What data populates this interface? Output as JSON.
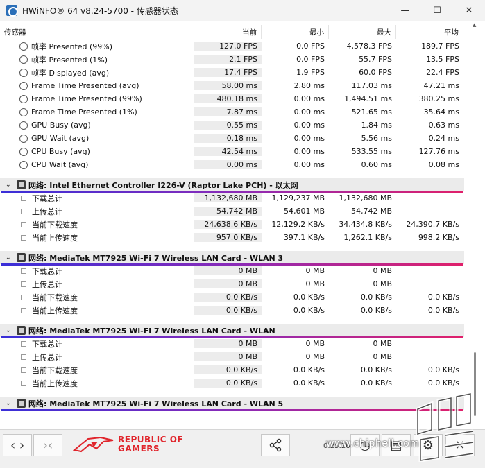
{
  "window": {
    "title": "HWiNFO® 64 v8.24-5700 - 传感器状态",
    "minimize": "—",
    "maximize": "☐",
    "close": "✕"
  },
  "columns": {
    "sensor": "传感器",
    "current": "当前",
    "min": "最小",
    "max": "最大",
    "avg": "平均"
  },
  "frame_rows": [
    {
      "name": "帧率 Presented (99%)",
      "current": "127.0 FPS",
      "min": "0.0 FPS",
      "max": "4,578.3 FPS",
      "avg": "189.7 FPS"
    },
    {
      "name": "帧率 Presented (1%)",
      "current": "2.1 FPS",
      "min": "0.0 FPS",
      "max": "55.7 FPS",
      "avg": "13.5 FPS"
    },
    {
      "name": "帧率 Displayed (avg)",
      "current": "17.4 FPS",
      "min": "1.9 FPS",
      "max": "60.0 FPS",
      "avg": "22.4 FPS"
    },
    {
      "name": "Frame Time Presented (avg)",
      "current": "58.00 ms",
      "min": "2.80 ms",
      "max": "117.03 ms",
      "avg": "47.21 ms"
    },
    {
      "name": "Frame Time Presented (99%)",
      "current": "480.18 ms",
      "min": "0.00 ms",
      "max": "1,494.51 ms",
      "avg": "380.25 ms"
    },
    {
      "name": "Frame Time Presented (1%)",
      "current": "7.87 ms",
      "min": "0.00 ms",
      "max": "521.65 ms",
      "avg": "35.64 ms"
    },
    {
      "name": "GPU Busy (avg)",
      "current": "0.55 ms",
      "min": "0.00 ms",
      "max": "1.84 ms",
      "avg": "0.63 ms"
    },
    {
      "name": "GPU Wait (avg)",
      "current": "0.18 ms",
      "min": "0.00 ms",
      "max": "5.56 ms",
      "avg": "0.24 ms"
    },
    {
      "name": "CPU Busy (avg)",
      "current": "42.54 ms",
      "min": "0.00 ms",
      "max": "533.55 ms",
      "avg": "127.76 ms"
    },
    {
      "name": "CPU Wait (avg)",
      "current": "0.00 ms",
      "min": "0.00 ms",
      "max": "0.60 ms",
      "avg": "0.08 ms"
    }
  ],
  "groups": [
    {
      "title": "网络: Intel Ethernet Controller I226-V (Raptor Lake PCH) - 以太网",
      "rows": [
        {
          "name": "下载总计",
          "current": "1,132,680 MB",
          "min": "1,129,237 MB",
          "max": "1,132,680 MB",
          "avg": ""
        },
        {
          "name": "上传总计",
          "current": "54,742 MB",
          "min": "54,601 MB",
          "max": "54,742 MB",
          "avg": ""
        },
        {
          "name": "当前下载速度",
          "current": "24,638.6 KB/s",
          "min": "12,129.2 KB/s",
          "max": "34,434.8 KB/s",
          "avg": "24,390.7 KB/s"
        },
        {
          "name": "当前上传速度",
          "current": "957.0 KB/s",
          "min": "397.1 KB/s",
          "max": "1,262.1 KB/s",
          "avg": "998.2 KB/s"
        }
      ]
    },
    {
      "title": "网络: MediaTek MT7925 Wi-Fi 7 Wireless LAN Card - WLAN 3",
      "rows": [
        {
          "name": "下载总计",
          "current": "0 MB",
          "min": "0 MB",
          "max": "0 MB",
          "avg": ""
        },
        {
          "name": "上传总计",
          "current": "0 MB",
          "min": "0 MB",
          "max": "0 MB",
          "avg": ""
        },
        {
          "name": "当前下载速度",
          "current": "0.0 KB/s",
          "min": "0.0 KB/s",
          "max": "0.0 KB/s",
          "avg": "0.0 KB/s"
        },
        {
          "name": "当前上传速度",
          "current": "0.0 KB/s",
          "min": "0.0 KB/s",
          "max": "0.0 KB/s",
          "avg": "0.0 KB/s"
        }
      ]
    },
    {
      "title": "网络: MediaTek MT7925 Wi-Fi 7 Wireless LAN Card - WLAN",
      "rows": [
        {
          "name": "下载总计",
          "current": "0 MB",
          "min": "0 MB",
          "max": "0 MB",
          "avg": ""
        },
        {
          "name": "上传总计",
          "current": "0 MB",
          "min": "0 MB",
          "max": "0 MB",
          "avg": ""
        },
        {
          "name": "当前下载速度",
          "current": "0.0 KB/s",
          "min": "0.0 KB/s",
          "max": "0.0 KB/s",
          "avg": "0.0 KB/s"
        },
        {
          "name": "当前上传速度",
          "current": "0.0 KB/s",
          "min": "0.0 KB/s",
          "max": "0.0 KB/s",
          "avg": "0.0 KB/s"
        }
      ]
    },
    {
      "title": "网络: MediaTek MT7925 Wi-Fi 7 Wireless LAN Card - WLAN 5",
      "rows": []
    }
  ],
  "footer": {
    "brand_line1": "REPUBLIC OF",
    "brand_line2": "GAMERS",
    "elapsed": "0:25:26",
    "watermark": "www.chiphell.com"
  }
}
